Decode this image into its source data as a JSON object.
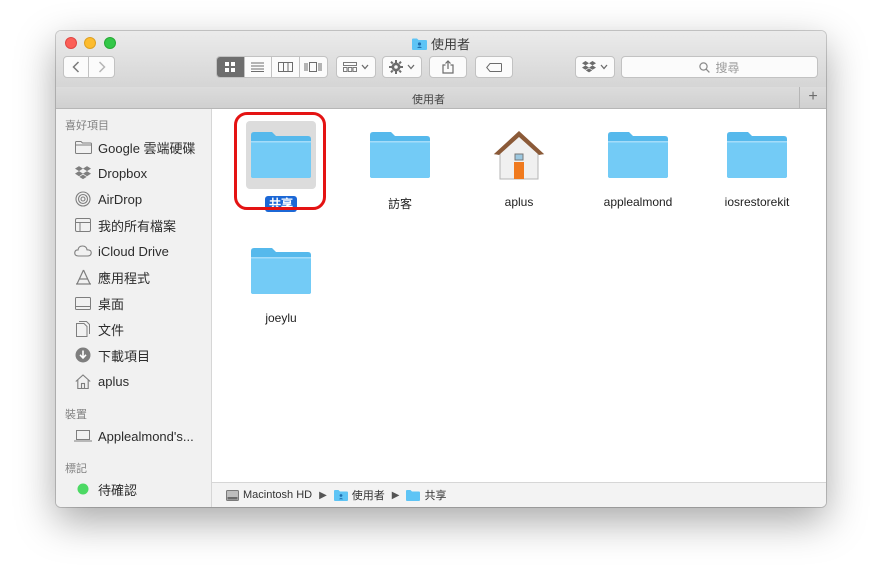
{
  "window": {
    "title": "使用者",
    "path_title": "使用者",
    "search_placeholder": "搜尋",
    "add_tab_label": "+"
  },
  "sidebar": {
    "sections": [
      {
        "header": "喜好項目",
        "items": [
          {
            "label": "Google 雲端硬碟",
            "icon": "folder-icon"
          },
          {
            "label": "Dropbox",
            "icon": "dropbox-icon"
          },
          {
            "label": "AirDrop",
            "icon": "airdrop-icon"
          },
          {
            "label": "我的所有檔案",
            "icon": "all-files-icon"
          },
          {
            "label": "iCloud Drive",
            "icon": "cloud-icon"
          },
          {
            "label": "應用程式",
            "icon": "applications-icon"
          },
          {
            "label": "桌面",
            "icon": "desktop-icon"
          },
          {
            "label": "文件",
            "icon": "documents-icon"
          },
          {
            "label": "下載項目",
            "icon": "download-icon"
          },
          {
            "label": "aplus",
            "icon": "home-icon"
          }
        ]
      },
      {
        "header": "裝置",
        "items": [
          {
            "label": "Applealmond's...",
            "icon": "laptop-icon"
          }
        ]
      },
      {
        "header": "標記",
        "items": [
          {
            "label": "待確認",
            "icon": "green-tag-icon",
            "color": "#4cd964"
          }
        ]
      }
    ]
  },
  "files": [
    {
      "name": "共享",
      "icon": "folder-icon",
      "selected": true
    },
    {
      "name": "訪客",
      "icon": "folder-icon",
      "selected": false
    },
    {
      "name": "aplus",
      "icon": "home-folder-icon",
      "selected": false
    },
    {
      "name": "applealmond",
      "icon": "folder-icon",
      "selected": false
    },
    {
      "name": "iosrestorekit",
      "icon": "folder-icon",
      "selected": false
    },
    {
      "name": "joeylu",
      "icon": "folder-icon",
      "selected": false
    }
  ],
  "statusbar": {
    "crumbs": [
      {
        "label": "Macintosh HD",
        "icon": "hard-drive-icon"
      },
      {
        "label": "使用者",
        "icon": "users-folder-icon"
      },
      {
        "label": "共享",
        "icon": "folder-icon"
      }
    ]
  },
  "colors": {
    "folder": "#5ec4f5",
    "selection": "#1c68d6",
    "highlight_ring": "#e41313",
    "tag_green": "#4cd964"
  }
}
